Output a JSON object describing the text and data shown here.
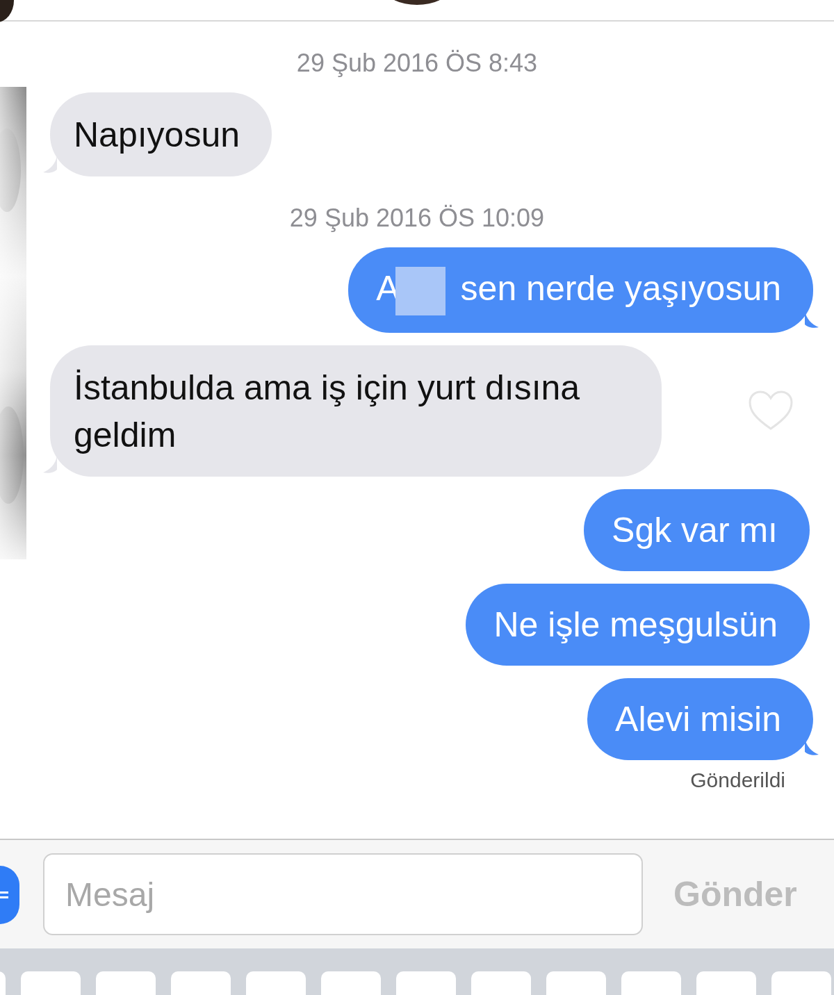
{
  "messages": [
    {
      "kind": "time",
      "text": "29 Şub 2016 ÖS 8:43"
    },
    {
      "kind": "received",
      "text": "Napıyosun",
      "tail": true
    },
    {
      "kind": "time",
      "text": "29 Şub 2016 ÖS 10:09"
    },
    {
      "kind": "sent",
      "text_start": "A",
      "redacted": true,
      "text": "sen nerde yaşıyosun",
      "tail": true
    },
    {
      "kind": "received",
      "text": "İstanbulda ama iş için yurt dısına geldim",
      "tail": true,
      "liked": false
    },
    {
      "kind": "sent",
      "text": "Sgk var mı",
      "tail": false
    },
    {
      "kind": "sent",
      "text": "Ne işle meşgulsün",
      "tail": false
    },
    {
      "kind": "sent",
      "text": "Alevi misin",
      "tail": true
    },
    {
      "kind": "status",
      "text": "Gönderildi"
    }
  ],
  "composer": {
    "placeholder": "Mesaj",
    "send": "Gönder",
    "send_disabled": true
  }
}
